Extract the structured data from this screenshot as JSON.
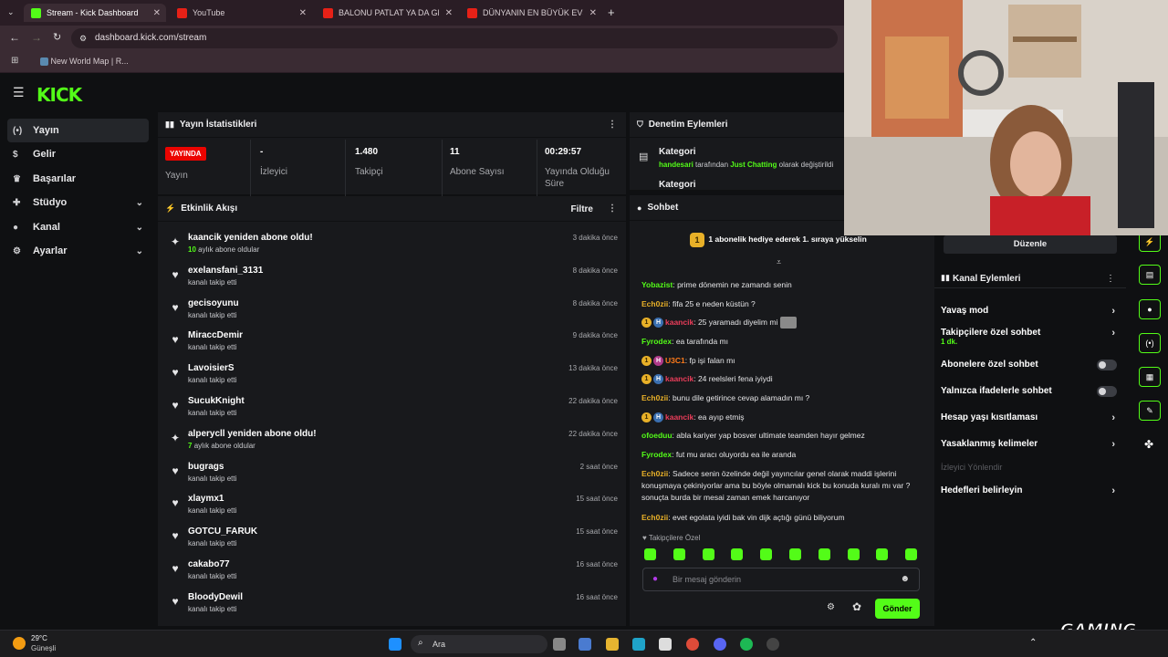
{
  "browser": {
    "tabs": [
      {
        "title": "Stream - Kick Dashboard",
        "active": true
      },
      {
        "title": "YouTube",
        "active": false
      },
      {
        "title": "BALONU PATLAT YA DA GERÇE",
        "active": false
      },
      {
        "title": "DÜNYANIN EN BÜYÜK EVSİZ K",
        "active": false
      }
    ],
    "url": "dashboard.kick.com/stream",
    "bookmark": "New World Map | R..."
  },
  "logo": "KICK",
  "sidebar": {
    "items": [
      {
        "label": "Yayın",
        "active": true,
        "icon": "broadcast-icon"
      },
      {
        "label": "Gelir",
        "icon": "money-icon"
      },
      {
        "label": "Başarılar",
        "icon": "trophy-icon"
      },
      {
        "label": "Stüdyo",
        "icon": "studio-icon",
        "expand": true
      },
      {
        "label": "Kanal",
        "icon": "user-icon",
        "expand": true
      },
      {
        "label": "Ayarlar",
        "icon": "gear-icon",
        "expand": true
      }
    ]
  },
  "stats": {
    "title": "Yayın İstatistikleri",
    "items": [
      {
        "value": "YAYINDA",
        "label": "Yayın"
      },
      {
        "value": "-",
        "label": "İzleyici"
      },
      {
        "value": "1.480",
        "label": "Takipçi"
      },
      {
        "value": "11",
        "label": "Abone Sayısı"
      },
      {
        "value": "00:29:57",
        "label": "Yayında Olduğu Süre"
      }
    ]
  },
  "moderation": {
    "title": "Denetim Eylemleri",
    "item_title": "Kategori",
    "item_user": "handesari",
    "item_mid": "tarafından",
    "item_cat": "Just Chatting",
    "item_tail": "olarak değiştirildi",
    "item2": "Kategori"
  },
  "activity": {
    "title": "Etkinlik Akışı",
    "filter": "Filtre",
    "items": [
      {
        "name": "kaancik yeniden abone oldu!",
        "num": "10",
        "sub": "aylık abone oldular",
        "time": "3 dakika önce",
        "type": "sub"
      },
      {
        "name": "exelansfani_3131",
        "sub": "kanalı takip etti",
        "time": "8 dakika önce",
        "type": "follow"
      },
      {
        "name": "gecisoyunu",
        "sub": "kanalı takip etti",
        "time": "8 dakika önce",
        "type": "follow"
      },
      {
        "name": "MiraccDemir",
        "sub": "kanalı takip etti",
        "time": "9 dakika önce",
        "type": "follow"
      },
      {
        "name": "LavoisierS",
        "sub": "kanalı takip etti",
        "time": "13 dakika önce",
        "type": "follow"
      },
      {
        "name": "SucukKnight",
        "sub": "kanalı takip etti",
        "time": "22 dakika önce",
        "type": "follow"
      },
      {
        "name": "alperycll yeniden abone oldu!",
        "num": "7",
        "sub": "aylık abone oldular",
        "time": "22 dakika önce",
        "type": "sub"
      },
      {
        "name": "bugrags",
        "sub": "kanalı takip etti",
        "time": "2 saat önce",
        "type": "follow"
      },
      {
        "name": "xlaymx1",
        "sub": "kanalı takip etti",
        "time": "15 saat önce",
        "type": "follow"
      },
      {
        "name": "GOTCU_FARUK",
        "sub": "kanalı takip etti",
        "time": "15 saat önce",
        "type": "follow"
      },
      {
        "name": "cakabo77",
        "sub": "kanalı takip etti",
        "time": "16 saat önce",
        "type": "follow"
      },
      {
        "name": "BloodyDewil",
        "sub": "kanalı takip etti",
        "time": "16 saat önce",
        "type": "follow"
      }
    ]
  },
  "chat": {
    "title": "Sohbet",
    "pinned_badge": "1",
    "pinned": "1 abonelik hediye ederek 1. sıraya yükselin",
    "messages": [
      {
        "user": "Yobazist",
        "color": "#53fc18",
        "text": "prime dönemin ne zamandı senin"
      },
      {
        "user": "Ech0zii",
        "color": "#e8b028",
        "text": "fifa 25 e neden küstün ?"
      },
      {
        "user": "kaancik",
        "color": "#eb3d5a",
        "text": "25 yaramadı diyelim mi",
        "badges": [
          "1",
          "H"
        ],
        "emote": true
      },
      {
        "user": "Fyrodex",
        "color": "#53fc18",
        "text": "ea tarafında mı"
      },
      {
        "user": "U3C1",
        "color": "#ff7a1a",
        "text": "fp işi falan mı",
        "badges": [
          "1",
          "H"
        ],
        "b3": true
      },
      {
        "user": "kaancik",
        "color": "#eb3d5a",
        "text": "24 reelsleri fena iyiydi",
        "badges": [
          "1",
          "H"
        ]
      },
      {
        "user": "Ech0zii",
        "color": "#e8b028",
        "text": "bunu dile getirince cevap alamadın mı ?"
      },
      {
        "user": "kaancik",
        "color": "#eb3d5a",
        "text": "ea ayıp etmiş",
        "badges": [
          "1",
          "H"
        ]
      },
      {
        "user": "ofoeduu",
        "color": "#53fc18",
        "text": "abla kariyer yap bosver ultimate teamden hayır gelmez"
      },
      {
        "user": "Fyrodex",
        "color": "#53fc18",
        "text": "fut mu aracı oluyordu ea ile aranda"
      },
      {
        "user": "Ech0zii",
        "color": "#e8b028",
        "text": "Sadece senin özelinde değil yayıncılar genel olarak maddi işlerini konuşmaya çekiniyorlar ama bu böyle olmamalı kick bu konuda kuralı mı var ? sonuçta burda bir mesai zaman emek harcanıyor"
      },
      {
        "user": "Ech0zii",
        "color": "#e8b028",
        "text": "evet egolata iyidi bak vin dijk açtığı günü biliyorum"
      }
    ],
    "followers_only": "Takipçilere Özel",
    "placeholder": "Bir mesaj gönderin",
    "send": "Gönder"
  },
  "channel_actions": {
    "edit": "Düzenle",
    "title": "Kanal Eylemleri",
    "items": [
      {
        "label": "Yavaş mod",
        "kind": "arrow"
      },
      {
        "label": "Takipçilere özel sohbet",
        "sub": "1 dk.",
        "kind": "arrow"
      },
      {
        "label": "Abonelere özel sohbet",
        "kind": "toggle"
      },
      {
        "label": "Yalnızca ifadelerle sohbet",
        "kind": "toggle"
      },
      {
        "label": "Hesap yaşı kısıtlaması",
        "kind": "arrow"
      },
      {
        "label": "Yasaklanmış kelimeler",
        "kind": "arrow"
      },
      {
        "label": "İzleyici Yönlendir",
        "kind": "disabled"
      },
      {
        "label": "Hedefleri belirleyin",
        "kind": "arrow"
      }
    ]
  },
  "taskbar": {
    "temp": "29°C",
    "weather": "Güneşli",
    "search": "Ara"
  },
  "watermark": "GAMING",
  "colors": {
    "brand": "#53fc18",
    "live": "#eb0400",
    "panel": "#18191c"
  }
}
